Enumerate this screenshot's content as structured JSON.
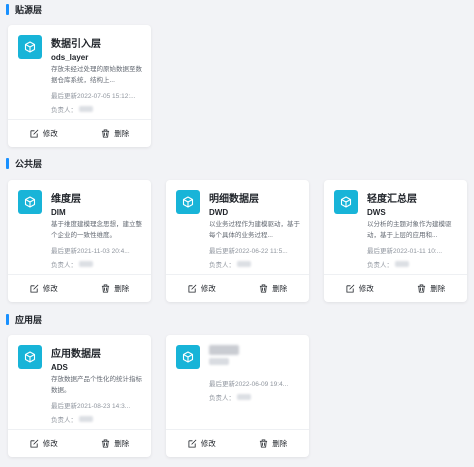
{
  "sections": [
    {
      "title": "贴源层"
    },
    {
      "title": "公共层"
    },
    {
      "title": "应用层"
    }
  ],
  "actions": {
    "edit": "修改",
    "delete": "删除"
  },
  "owner_label": "负责人：",
  "cards": [
    {
      "name": "数据引入层",
      "code": "ods_layer",
      "desc": "存放未经过处理的原始数据至数据仓库系统，结构上...",
      "time": "最后更新2022-07-05 15:12:..."
    },
    {
      "name": "维度层",
      "code": "DIM",
      "desc": "基于维度建模理念思想，建立整个企业的一致性维度。",
      "time": "最后更新2021-11-03 20:4..."
    },
    {
      "name": "明细数据层",
      "code": "DWD",
      "desc": "以业务过程作为建模驱动，基于每个具体的业务过程...",
      "time": "最后更新2022-06-22 11:5..."
    },
    {
      "name": "轻度汇总层",
      "code": "DWS",
      "desc": "以分析的主题对象作为建模驱动，基于上层的应用和...",
      "time": "最后更新2022-01-11 10:..."
    },
    {
      "name": "应用数据层",
      "code": "ADS",
      "desc": "存放数据产品个性化的统计指标数据。",
      "time": "最后更新2021-08-23 14:3..."
    },
    {
      "name": "",
      "code": "",
      "desc": "",
      "time": "最后更新2022-06-09 19:4..."
    }
  ]
}
